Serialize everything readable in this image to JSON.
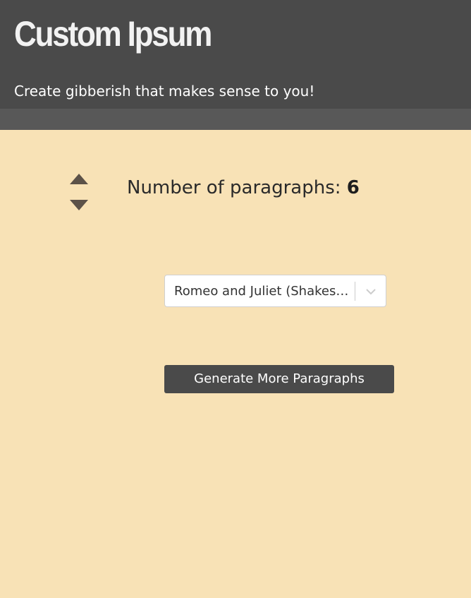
{
  "header": {
    "title": "Custom Ipsum",
    "subtitle": "Create gibberish that makes sense to you!"
  },
  "paragraphs": {
    "label": "Number of paragraphs: ",
    "count": "6",
    "increment_icon": "triangle-up-icon",
    "decrement_icon": "triangle-down-icon"
  },
  "source_select": {
    "selected": "Romeo and Juliet (Shakespeare)",
    "chevron_icon": "chevron-down-icon"
  },
  "actions": {
    "generate_label": "Generate More Paragraphs"
  },
  "colors": {
    "page_background": "#f8e2b6",
    "header_background": "#4a4a4a",
    "header_band": "#585858",
    "button_background": "#4a4a4a",
    "arrow": "#5c5248"
  }
}
